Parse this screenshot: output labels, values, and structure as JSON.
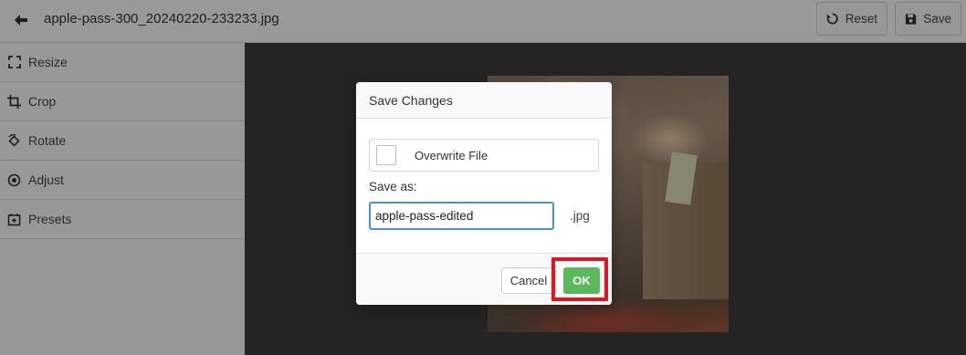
{
  "topbar": {
    "back_icon": "arrow-left-icon",
    "file_title": "apple-pass-300_20240220-233233.jpg",
    "reset_label": "Reset",
    "reset_icon": "undo-icon",
    "save_label": "Save",
    "save_icon": "floppy-disk-icon"
  },
  "sidebar": {
    "items": [
      {
        "label": "Resize",
        "icon": "resize-icon"
      },
      {
        "label": "Crop",
        "icon": "crop-icon"
      },
      {
        "label": "Rotate",
        "icon": "rotate-icon"
      },
      {
        "label": "Adjust",
        "icon": "adjust-icon"
      },
      {
        "label": "Presets",
        "icon": "presets-icon"
      }
    ]
  },
  "dialog": {
    "title": "Save Changes",
    "overwrite_label": "Overwrite File",
    "overwrite_checked": false,
    "save_as_label": "Save as:",
    "filename_value": "apple-pass-edited",
    "extension": ".jpg",
    "cancel_label": "Cancel",
    "ok_label": "OK"
  },
  "colors": {
    "ok_green": "#5cb85c",
    "highlight_red": "#e2141f",
    "input_focus_blue": "#4a90d9"
  }
}
